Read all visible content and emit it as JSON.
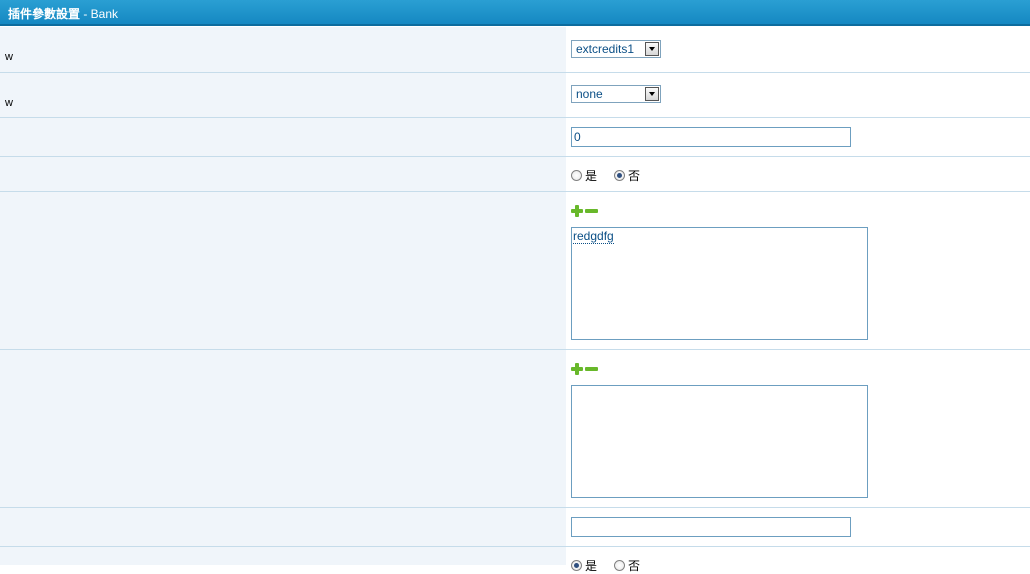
{
  "header": {
    "title": "插件參數設置",
    "subtitle": " - Bank"
  },
  "rows": [
    {
      "label": "w",
      "select_value": "extcredits1"
    },
    {
      "label": "w",
      "select_value": "none"
    },
    {
      "input_value": "0"
    },
    {
      "radio_yes": "是",
      "radio_no": "否",
      "selected": "否"
    },
    {
      "textarea_value": "redgdfg"
    },
    {
      "textarea_value": ""
    },
    {
      "input_value": ""
    },
    {
      "radio_yes": "是",
      "radio_no": "否",
      "selected": "是"
    }
  ]
}
